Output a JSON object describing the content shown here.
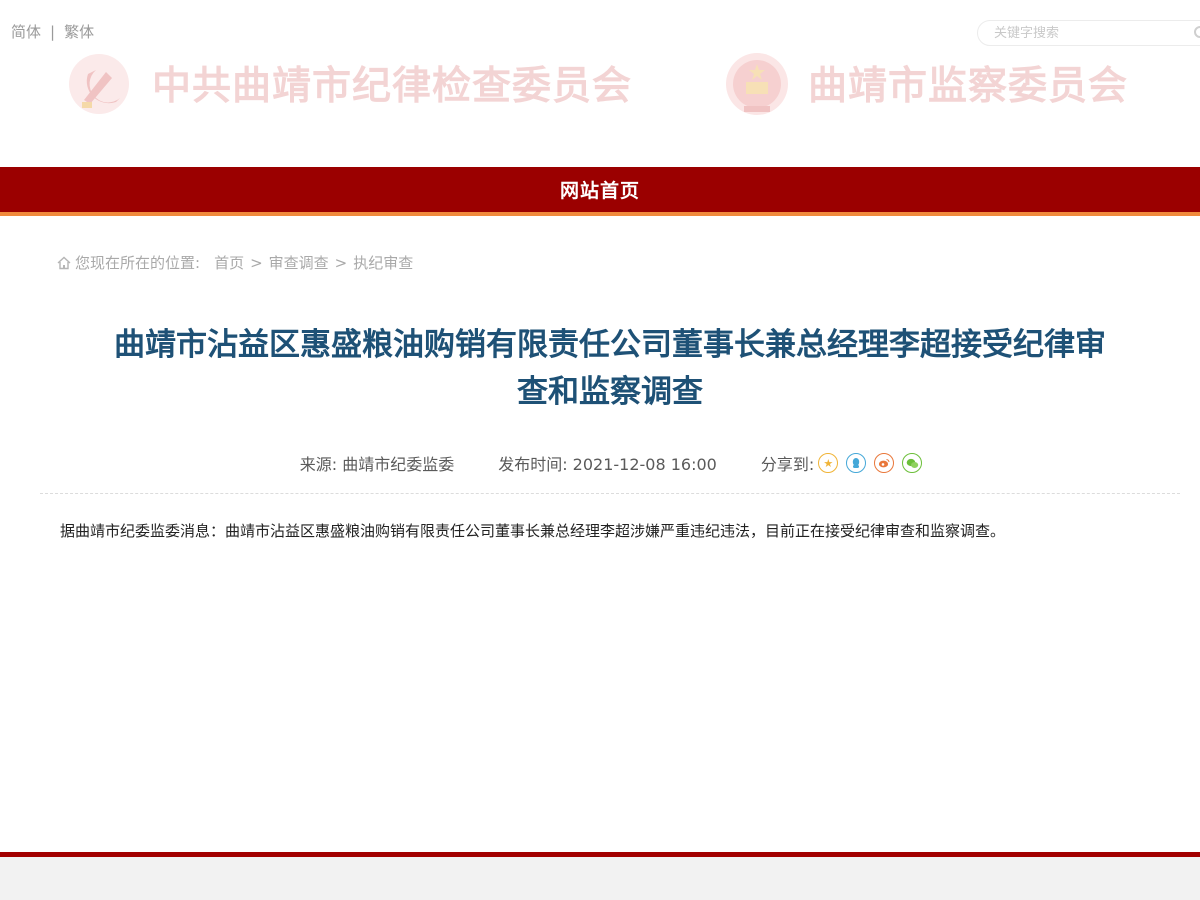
{
  "header": {
    "lang": {
      "simplified": "简体",
      "separator": "|",
      "traditional": "繁体"
    },
    "search": {
      "placeholder": "关键字搜索"
    },
    "banner_left_title": "中共曲靖市纪律检查委员会",
    "banner_right_title": "曲靖市监察委员会"
  },
  "nav": {
    "home": "网站首页"
  },
  "breadcrumb": {
    "prefix": "您现在所在的位置:",
    "items": [
      "首页",
      "审查调查",
      "执纪审查"
    ],
    "separator": ">"
  },
  "article": {
    "title": "曲靖市沾益区惠盛粮油购销有限责任公司董事长兼总经理李超接受纪律审查和监察调查",
    "source": "来源: 曲靖市纪委监委",
    "published": "发布时间: 2021-12-08 16:00",
    "share_label": "分享到:",
    "share_icons": [
      "favorite-icon",
      "qq-icon",
      "weibo-icon",
      "wechat-icon"
    ],
    "body": "据曲靖市纪委监委消息：曲靖市沾益区惠盛粮油购销有限责任公司董事长兼总经理李超涉嫌严重违纪违法，目前正在接受纪律审查和监察调查。"
  },
  "colors": {
    "nav_red": "#9b0000",
    "nav_accent": "#f08a3c",
    "title_blue": "#1e5176",
    "banner_pink": "#f3d4d4"
  }
}
